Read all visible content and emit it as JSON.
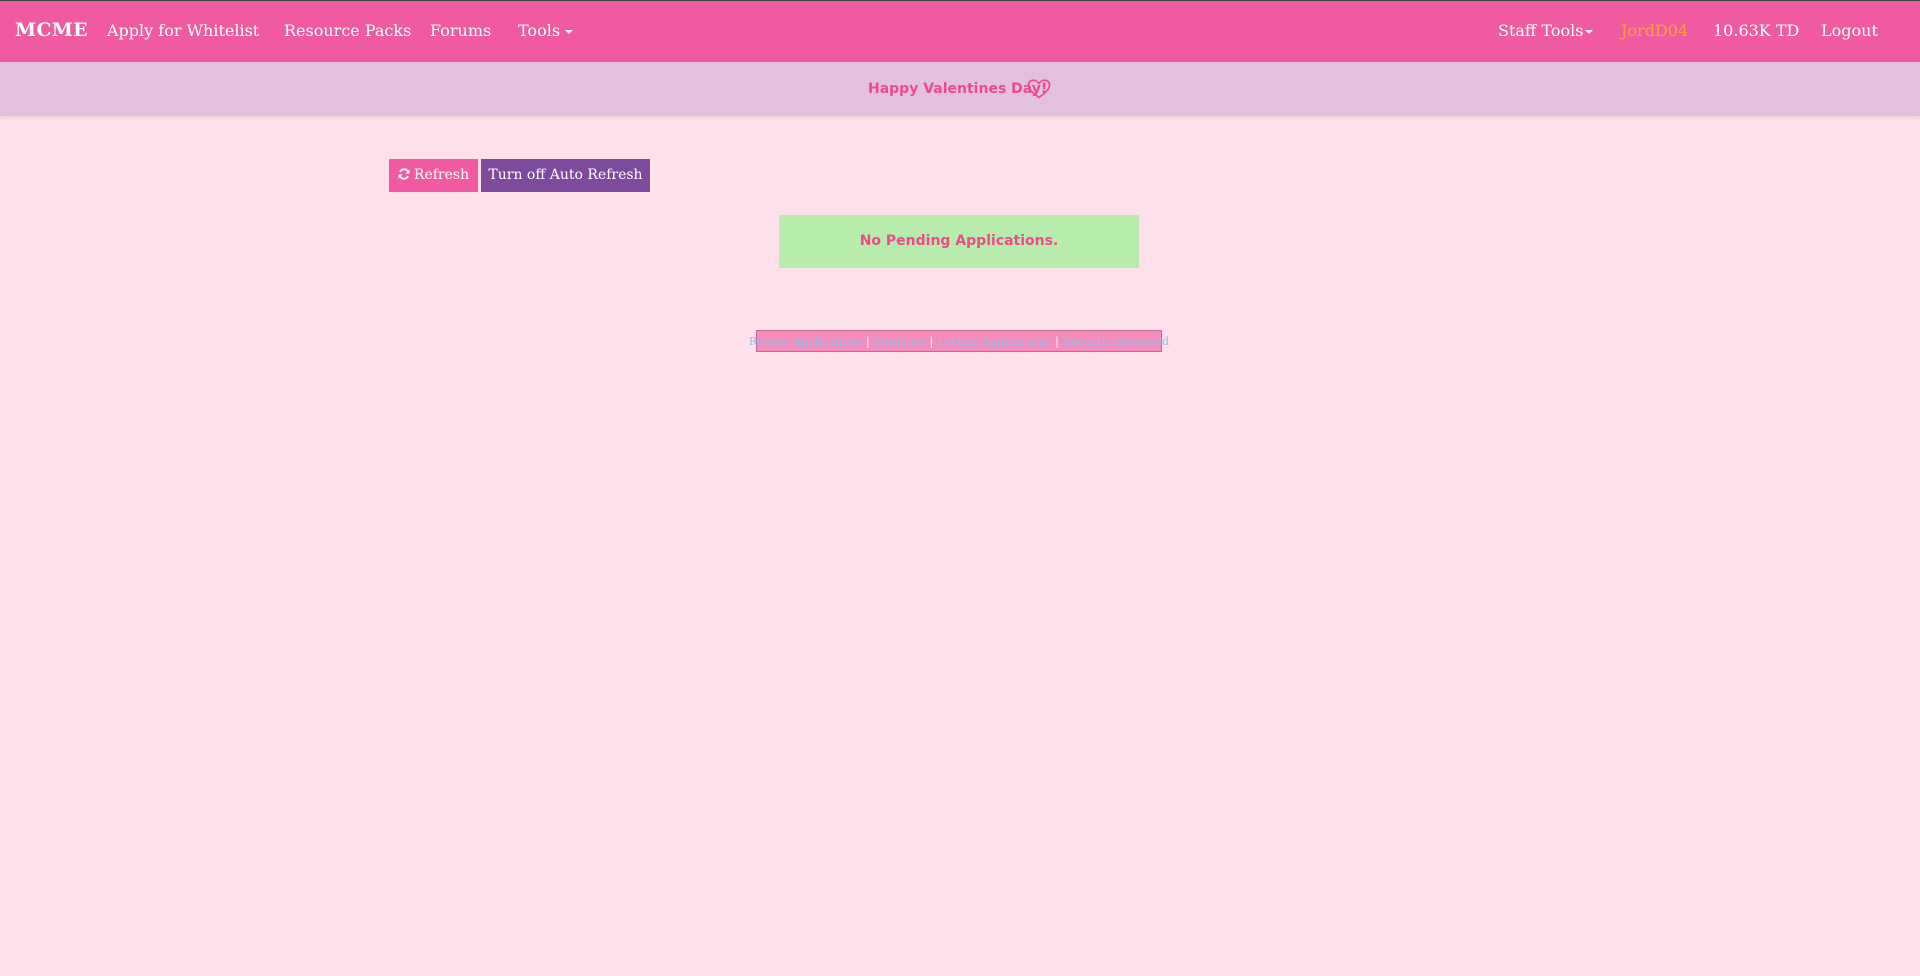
{
  "nav": {
    "brand": "MCME",
    "items": [
      {
        "label": "Apply for Whitelist"
      },
      {
        "label": "Resource Packs"
      },
      {
        "label": "Forums"
      },
      {
        "label": "Tools"
      }
    ],
    "right": {
      "staff_tools": "Staff Tools",
      "user": "JordD04",
      "balance": "10.63K TD",
      "logout": "Logout"
    }
  },
  "banner": {
    "text": "Happy Valentines Day!",
    "icon": "heart-outline-icon"
  },
  "actions": {
    "refresh_label": "Refresh",
    "refresh_icon": "refresh-icon",
    "auto_refresh_label": "Turn off Auto Refresh"
  },
  "alert": {
    "message": "No Pending Applications."
  },
  "footer_links": [
    {
      "label": "Review Applications"
    },
    {
      "label": "Statistics"
    },
    {
      "label": "Lookup Applications"
    },
    {
      "label": "Recently Reviewed"
    }
  ],
  "colors": {
    "page_bg": "#fde0ea",
    "navbar": "#f05aa0",
    "banner_bg": "#e3c1dc",
    "accent_pink": "#ee4b8e",
    "purple_button": "#7e4a9c",
    "alert_bg": "#b8ecac",
    "username": "#ffa03c",
    "footer_link": "#8ec0e8"
  }
}
